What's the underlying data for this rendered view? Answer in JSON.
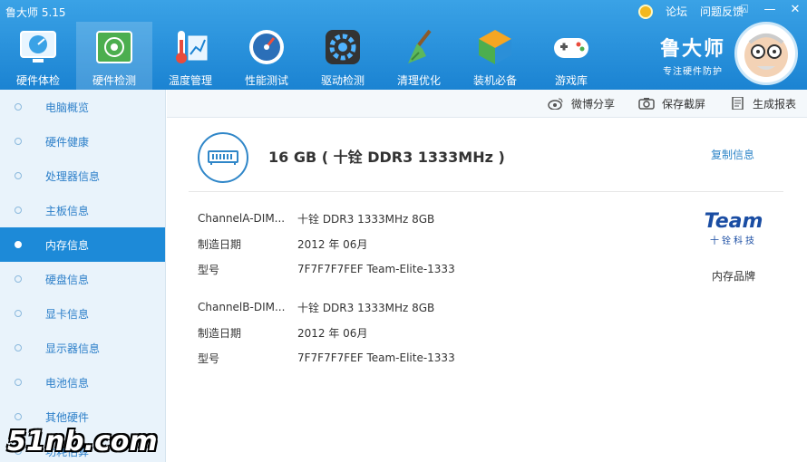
{
  "app": {
    "title": "鲁大师 5.15"
  },
  "top_links": {
    "forum": "论坛",
    "feedback": "问题反馈"
  },
  "window_controls": {
    "pin": "⍓",
    "minimize": "—",
    "close": "✕"
  },
  "nav": [
    {
      "label": "硬件体检",
      "icon": "dial-monitor-icon"
    },
    {
      "label": "硬件检测",
      "icon": "chip-board-icon"
    },
    {
      "label": "温度管理",
      "icon": "thermometer-icon"
    },
    {
      "label": "性能测试",
      "icon": "speedometer-icon"
    },
    {
      "label": "驱动检测",
      "icon": "gear-driver-icon"
    },
    {
      "label": "清理优化",
      "icon": "broom-icon"
    },
    {
      "label": "装机必备",
      "icon": "cube-icon"
    },
    {
      "label": "游戏库",
      "icon": "gamepad-icon"
    }
  ],
  "brand": {
    "name": "鲁大师",
    "slogan": "专注硬件防护"
  },
  "sidebar": [
    "电脑概览",
    "硬件健康",
    "处理器信息",
    "主板信息",
    "内存信息",
    "硬盘信息",
    "显卡信息",
    "显示器信息",
    "电池信息",
    "其他硬件",
    "功耗估算"
  ],
  "toolbar": {
    "share": "微博分享",
    "screenshot": "保存截屏",
    "report": "生成报表"
  },
  "summary": {
    "text": "16 GB ( 十铨 DDR3 1333MHz )",
    "copy": "复制信息"
  },
  "modules": [
    {
      "slot_key": "ChannelA-DIM...",
      "slot_val": "十铨 DDR3 1333MHz 8GB",
      "date_key": "制造日期",
      "date_val": "2012 年 06月",
      "model_key": "型号",
      "model_val": "7F7F7F7FEF Team-Elite-1333"
    },
    {
      "slot_key": "ChannelB-DIM...",
      "slot_val": "十铨 DDR3 1333MHz 8GB",
      "date_key": "制造日期",
      "date_val": "2012 年 06月",
      "model_key": "型号",
      "model_val": "7F7F7F7FEF Team-Elite-1333"
    }
  ],
  "brand_logo": {
    "word": "Team",
    "cn": "十铨科技",
    "caption": "内存品牌"
  },
  "watermark": "51nb.com",
  "colors": {
    "header": "#1b83d2",
    "active": "#1d8ad8",
    "link": "#2f86c8"
  }
}
